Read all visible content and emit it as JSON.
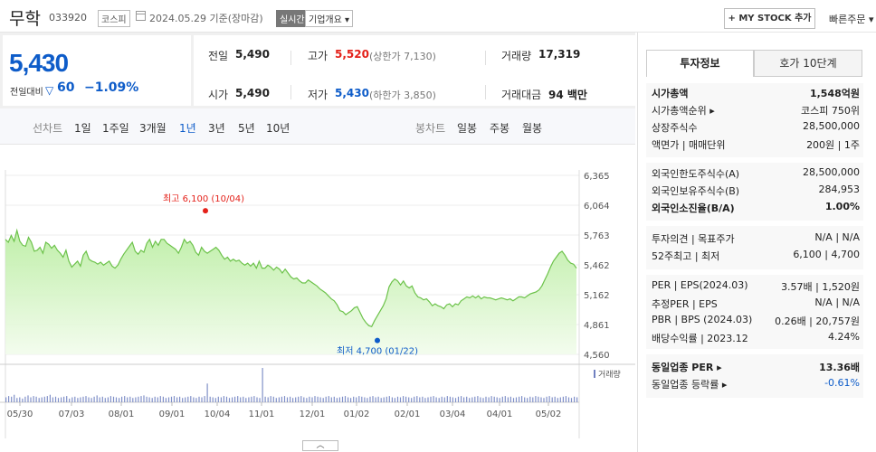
{
  "header": {
    "name": "무학",
    "code": "033920",
    "market": "코스피",
    "date": "2024.05.29  기준(장마감)",
    "realtime": "실시간",
    "company": "기업개요 ▾",
    "mystock": "+ MY STOCK 추가",
    "quick_order": "빠른주문 ▾"
  },
  "price": {
    "current": "5,430",
    "vs_label": "전일대비",
    "change": "60",
    "change_pct": "−1.09%"
  },
  "stats": {
    "prev_label": "전일",
    "prev": "5,490",
    "high_label": "고가",
    "high": "5,520",
    "upper_limit": "(상한가 7,130)",
    "volume_label": "거래량",
    "volume": "17,319",
    "open_label": "시가",
    "open": "5,490",
    "low_label": "저가",
    "low": "5,430",
    "lower_limit": "(하한가 3,850)",
    "amount_label": "거래대금",
    "amount": "94 백만"
  },
  "periods": {
    "line_label": "선차트",
    "line": [
      "1일",
      "1주일",
      "3개월",
      "1년",
      "3년",
      "5년",
      "10년"
    ],
    "active": "1년",
    "candle_label": "봉차트",
    "candle": [
      "일봉",
      "주봉",
      "월봉"
    ]
  },
  "chart_data": {
    "type": "area",
    "y_ticks": [
      "6,365",
      "6,064",
      "5,763",
      "5,462",
      "5,162",
      "4,861",
      "4,560"
    ],
    "ylim": [
      4560,
      6365
    ],
    "x_ticks": [
      "05/30",
      "07/03",
      "08/01",
      "09/01",
      "10/04",
      "11/01",
      "12/01",
      "01/02",
      "02/01",
      "03/04",
      "04/01",
      "05/02"
    ],
    "high_label": "최고 6,100 (10/04)",
    "low_label": "최저 4,700 (01/22)",
    "high": 6100,
    "low": 4700,
    "volume_label": "거래량",
    "series": [
      {
        "values": [
          5720,
          5690,
          5760,
          5700,
          5810,
          5700,
          5660,
          5650,
          5740,
          5690,
          5600,
          5610,
          5640,
          5580,
          5690,
          5670,
          5630,
          5660,
          5610,
          5580,
          5540,
          5610,
          5500,
          5440,
          5470,
          5500,
          5450,
          5560,
          5600,
          5520,
          5500,
          5490,
          5470,
          5490,
          5460,
          5480,
          5500,
          5450,
          5430,
          5460,
          5520,
          5570,
          5610,
          5650,
          5690,
          5600,
          5570,
          5610,
          5590,
          5680,
          5720,
          5640,
          5700,
          5660,
          5720,
          5720,
          5680,
          5660,
          5640,
          5620,
          5580,
          5640,
          5720,
          5680,
          5700,
          5660,
          5590,
          5560,
          5640,
          5600,
          5580,
          5600,
          5620,
          5640,
          5610,
          5560,
          5520,
          5540,
          5500,
          5520,
          5500,
          5510,
          5480,
          5460,
          5480,
          5450,
          5480,
          5430,
          5500,
          5430,
          5430,
          5460,
          5440,
          5410,
          5440,
          5420,
          5380,
          5420,
          5380,
          5340,
          5320,
          5330,
          5300,
          5280,
          5280,
          5310,
          5290,
          5270,
          5250,
          5220,
          5200,
          5180,
          5150,
          5120,
          5100,
          5060,
          5000,
          4990,
          4960,
          4980,
          5000,
          5030,
          5040,
          4980,
          4920,
          4880,
          4850,
          4840,
          4900,
          4950,
          5000,
          5050,
          5120,
          5240,
          5290,
          5320,
          5300,
          5260,
          5300,
          5250,
          5230,
          5250,
          5180,
          5140,
          5130,
          5110,
          5120,
          5090,
          5050,
          5070,
          5050,
          5040,
          5020,
          5060,
          5070,
          5040,
          5070,
          5060,
          5100,
          5120,
          5140,
          5130,
          5150,
          5130,
          5150,
          5120,
          5140,
          5130,
          5130,
          5120,
          5110,
          5120,
          5130,
          5120,
          5110,
          5120,
          5100,
          5120,
          5140,
          5140,
          5130,
          5150,
          5170,
          5180,
          5190,
          5210,
          5250,
          5310,
          5370,
          5440,
          5500,
          5540,
          5580,
          5600,
          5560,
          5510,
          5480,
          5470,
          5430
        ]
      }
    ],
    "volume_values": [
      8,
      10,
      9,
      12,
      7,
      8,
      6,
      9,
      11,
      8,
      10,
      9,
      7,
      8,
      9,
      10,
      12,
      8,
      9,
      7,
      8,
      9,
      10,
      6,
      8,
      9,
      7,
      8,
      9,
      10,
      8,
      7,
      9,
      11,
      8,
      9,
      7,
      8,
      10,
      9,
      8,
      7,
      9,
      10,
      8,
      9,
      7,
      8,
      9,
      10,
      11,
      9,
      8,
      7,
      9,
      8,
      10,
      9,
      7,
      8,
      9,
      10,
      8,
      9,
      7,
      8,
      9,
      10,
      8,
      7,
      9,
      8,
      10,
      30,
      9,
      8,
      7,
      9,
      8,
      10,
      9,
      7,
      8,
      9,
      10,
      8,
      9,
      7,
      8,
      9,
      10,
      8,
      7,
      55,
      9,
      8,
      10,
      9,
      7,
      8,
      9,
      10,
      8,
      9,
      7,
      8,
      9,
      10,
      8,
      7,
      9,
      8,
      10,
      9,
      8,
      7,
      9,
      10,
      8,
      9,
      7,
      8,
      9,
      10,
      8,
      7,
      9,
      8,
      10,
      9,
      8,
      7,
      9,
      10,
      8,
      9,
      7,
      8,
      9,
      10,
      8,
      7,
      9,
      8,
      10,
      9,
      8,
      7,
      9,
      10,
      8,
      9,
      7,
      8,
      9,
      10,
      8,
      7,
      9,
      8,
      10,
      9,
      8,
      7,
      9,
      10,
      8,
      9,
      7,
      8,
      9,
      10,
      8,
      7,
      9,
      8,
      10,
      9,
      8,
      7,
      9,
      10,
      8,
      9,
      7,
      8,
      9,
      10,
      8,
      7,
      9,
      8,
      10,
      9,
      8,
      7,
      9,
      10,
      8,
      9,
      7,
      8,
      9,
      10,
      8,
      7,
      9,
      8
    ]
  },
  "right_panel": {
    "tab_invest": "투자정보",
    "tab_hoga": "호가 10단계",
    "group1": [
      {
        "label": "시가총액",
        "value": "1,548억원",
        "bold": true
      },
      {
        "label": "시가총액순위 ▸",
        "value": "코스피 750위"
      },
      {
        "label": "상장주식수",
        "value": "28,500,000"
      },
      {
        "label": "액면가 | 매매단위",
        "value": "200원 | 1주"
      }
    ],
    "group2": [
      {
        "label": "외국인한도주식수(A)",
        "value": "28,500,000"
      },
      {
        "label": "외국인보유주식수(B)",
        "value": "284,953"
      },
      {
        "label": "외국인소진율(B/A)",
        "value": "1.00%",
        "bold": true
      }
    ],
    "group3": [
      {
        "label": "투자의견 | 목표주가",
        "value": "N/A | N/A"
      },
      {
        "label": "52주최고 | 최저",
        "value": "6,100 | 4,700"
      }
    ],
    "group4": [
      {
        "label": "PER | EPS(2024.03)",
        "value": "3.57배 | 1,520원"
      },
      {
        "label": "추정PER | EPS",
        "value": "N/A | N/A"
      },
      {
        "label": "PBR | BPS (2024.03)",
        "value": "0.26배 | 20,757원"
      },
      {
        "label": "배당수익률 | 2023.12",
        "value": "4.24%"
      }
    ],
    "group5": [
      {
        "label": "동일업종 PER ▸",
        "value": "13.36배",
        "bold": true
      },
      {
        "label": "동일업종 등락률 ▸",
        "value": "-0.61%",
        "blue": true
      }
    ]
  },
  "colors": {
    "accent": "#0e5cc9",
    "up": "#e4211a",
    "line": "#6cc24a",
    "area": "#d6f5c4"
  }
}
